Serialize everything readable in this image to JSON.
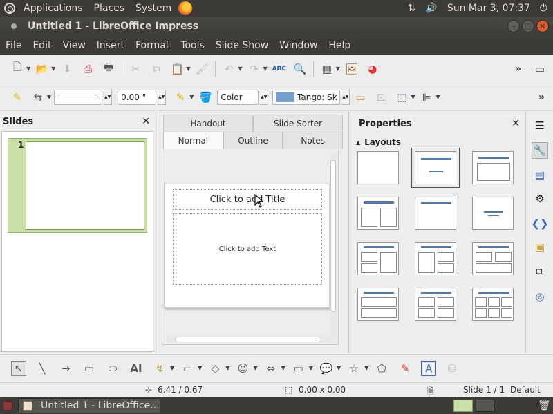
{
  "top_panel": {
    "menus": [
      "Applications",
      "Places",
      "System"
    ],
    "clock": "Sun Mar  3, 07:37"
  },
  "window": {
    "title": "Untitled 1 - LibreOffice Impress",
    "controls": [
      "minimize",
      "maximize",
      "close"
    ]
  },
  "menubar": [
    "File",
    "Edit",
    "View",
    "Insert",
    "Format",
    "Tools",
    "Slide Show",
    "Window",
    "Help"
  ],
  "toolbar2": {
    "line_width_value": "0.00 \"",
    "area_style": "Color",
    "fill_color": "Tango: Sky"
  },
  "slides_pane": {
    "title": "Slides",
    "slides": [
      {
        "number": "1"
      }
    ]
  },
  "view_tabs": {
    "row1": [
      "Handout",
      "Slide Sorter"
    ],
    "row2": [
      "Normal",
      "Outline",
      "Notes"
    ],
    "active": "Normal"
  },
  "slide": {
    "title_placeholder": "Click to add Title",
    "text_placeholder": "Click to add Text"
  },
  "properties": {
    "title": "Properties",
    "section": "Layouts",
    "selected_layout_index": 1
  },
  "statusbar": {
    "position": "6.41 / 0.67",
    "size": "0.00 x 0.00",
    "slide": "Slide 1 / 1",
    "master": "Default"
  },
  "taskbar": {
    "item": "Untitled 1 - LibreOffice..."
  },
  "colors": {
    "panel": "#3c3b37",
    "close": "#df5c2f",
    "thumb_selected": "#c8dfa8",
    "layout_bar": "#4f7aa8",
    "fill_swatch": "#729fcf"
  }
}
